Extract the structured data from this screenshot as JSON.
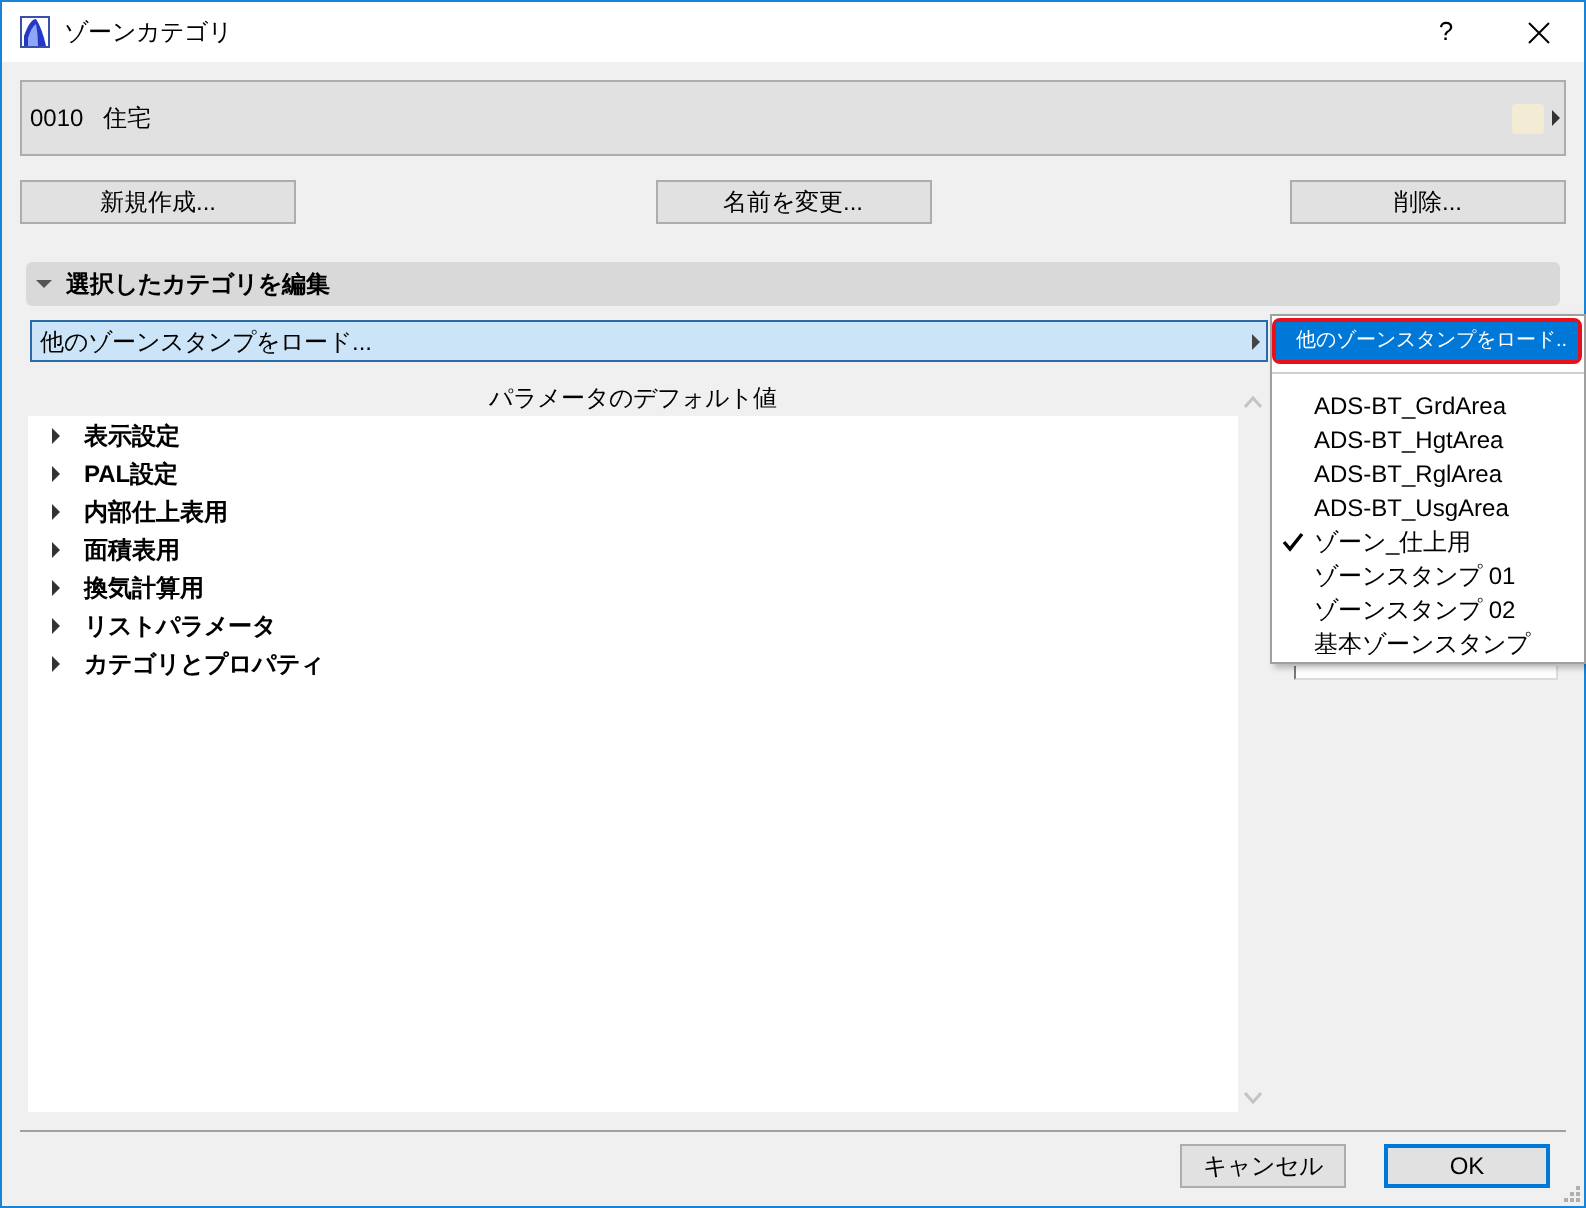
{
  "window": {
    "title": "ゾーンカテゴリ",
    "help": "?"
  },
  "category": {
    "code": "0010",
    "name": "住宅",
    "color": "#f3ebd3"
  },
  "buttons": [
    "新規作成...",
    "名前を変更...",
    "削除..."
  ],
  "section": {
    "title": "選択したカテゴリを編集",
    "expanded": true
  },
  "stamp_field": {
    "value": "他のゾーンスタンプをロード...",
    "open": true
  },
  "parameters": {
    "heading": "パラメータのデフォルト値",
    "items": [
      {
        "label": "表示設定",
        "expanded": false
      },
      {
        "label": "PAL設定",
        "expanded": false
      },
      {
        "label": "内部仕上表用",
        "expanded": false
      },
      {
        "label": "面積表用",
        "expanded": false
      },
      {
        "label": "換気計算用",
        "expanded": false
      },
      {
        "label": "リストパラメータ",
        "expanded": false
      },
      {
        "label": "カテゴリとプロパティ",
        "expanded": false
      }
    ]
  },
  "stamp_menu": {
    "command": {
      "label": "他のゾーンスタンプをロード..",
      "selected": true,
      "callout": true
    },
    "items": [
      {
        "label": "ADS-BT_GrdArea",
        "checked": false,
        "selected": false
      },
      {
        "label": "ADS-BT_HgtArea",
        "checked": false,
        "selected": false
      },
      {
        "label": "ADS-BT_RglArea",
        "checked": false,
        "selected": false
      },
      {
        "label": "ADS-BT_UsgArea",
        "checked": false,
        "selected": false
      },
      {
        "label": "ゾーン_仕上用",
        "checked": true,
        "selected": false
      },
      {
        "label": "ゾーンスタンプ 01",
        "checked": false,
        "selected": false
      },
      {
        "label": "ゾーンスタンプ 02",
        "checked": false,
        "selected": false
      },
      {
        "label": "基本ゾーンスタンプ",
        "checked": false,
        "selected": false
      }
    ]
  },
  "dialog_buttons": [
    {
      "label": "キャンセル",
      "default": false
    },
    {
      "label": "OK",
      "default": true
    }
  ]
}
